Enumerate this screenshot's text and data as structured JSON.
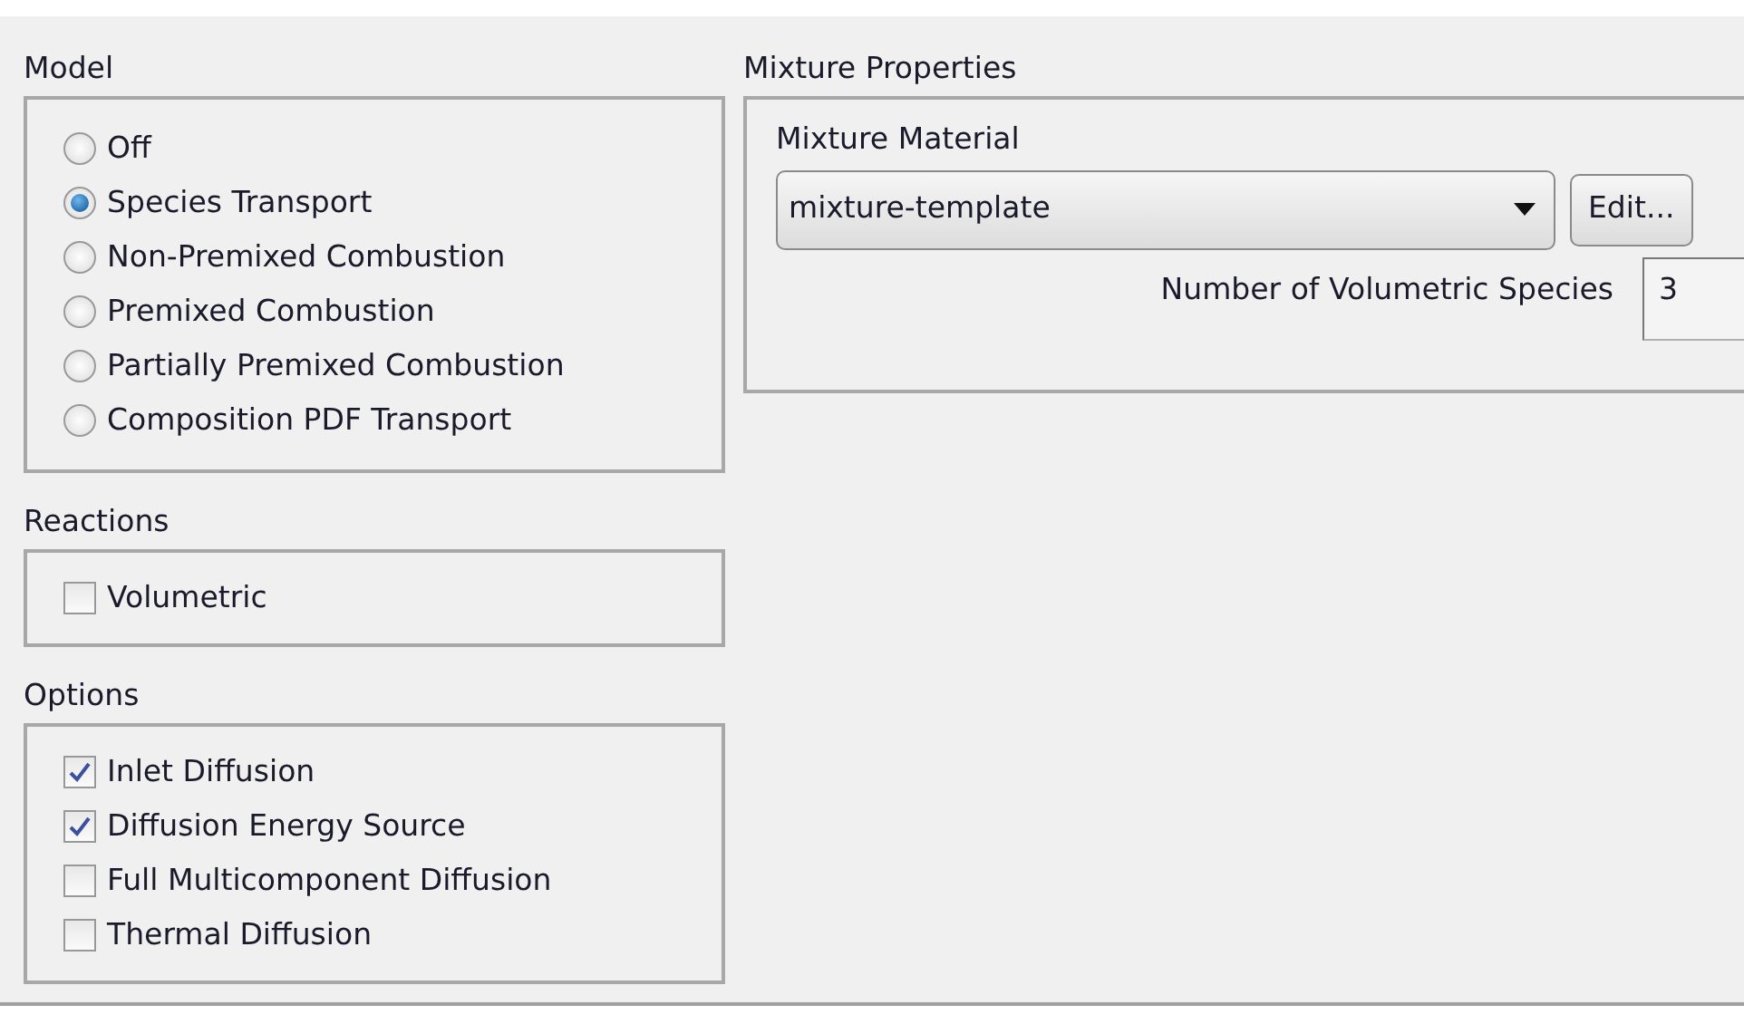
{
  "model": {
    "title": "Model",
    "options": [
      {
        "label": "Off",
        "selected": false
      },
      {
        "label": "Species Transport",
        "selected": true
      },
      {
        "label": "Non-Premixed Combustion",
        "selected": false
      },
      {
        "label": "Premixed Combustion",
        "selected": false
      },
      {
        "label": "Partially Premixed Combustion",
        "selected": false
      },
      {
        "label": "Composition PDF Transport",
        "selected": false
      }
    ]
  },
  "reactions": {
    "title": "Reactions",
    "items": [
      {
        "label": "Volumetric",
        "checked": false
      }
    ]
  },
  "options": {
    "title": "Options",
    "items": [
      {
        "label": "Inlet Diffusion",
        "checked": true
      },
      {
        "label": "Diffusion Energy Source",
        "checked": true
      },
      {
        "label": "Full Multicomponent Diffusion",
        "checked": false
      },
      {
        "label": "Thermal Diffusion",
        "checked": false
      }
    ]
  },
  "mixture_properties": {
    "title": "Mixture Properties",
    "material_label": "Mixture Material",
    "material_value": "mixture-template",
    "edit_button": "Edit...",
    "species_label": "Number of Volumetric Species",
    "species_value": "3"
  }
}
